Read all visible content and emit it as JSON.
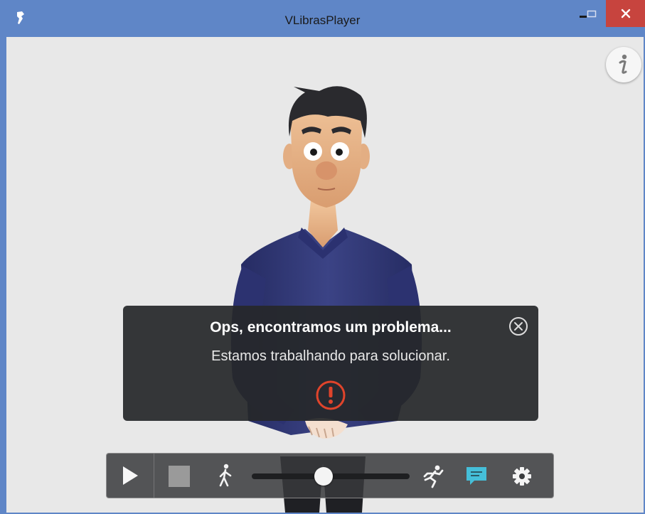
{
  "window": {
    "title": "VLibrasPlayer",
    "icons": {
      "app": "vlibras-hand-icon",
      "minimize": "minimize-icon",
      "maximize": "maximize-icon",
      "close": "close-icon"
    }
  },
  "info_button": {
    "icon": "info-icon"
  },
  "error_dialog": {
    "title": "Ops, encontramos um problema...",
    "message": "Estamos trabalhando para solucionar.",
    "close_icon": "close-circle-icon",
    "status_icon": "warning-icon",
    "accent_color": "#e0442b"
  },
  "controls": {
    "play_icon": "play-icon",
    "stop_icon": "stop-icon",
    "slow_icon": "walk-icon",
    "fast_icon": "run-icon",
    "subtitle_icon": "subtitle-icon",
    "settings_icon": "gear-icon",
    "speed_value": 0.45,
    "subtitle_active_color": "#45bfd9"
  }
}
